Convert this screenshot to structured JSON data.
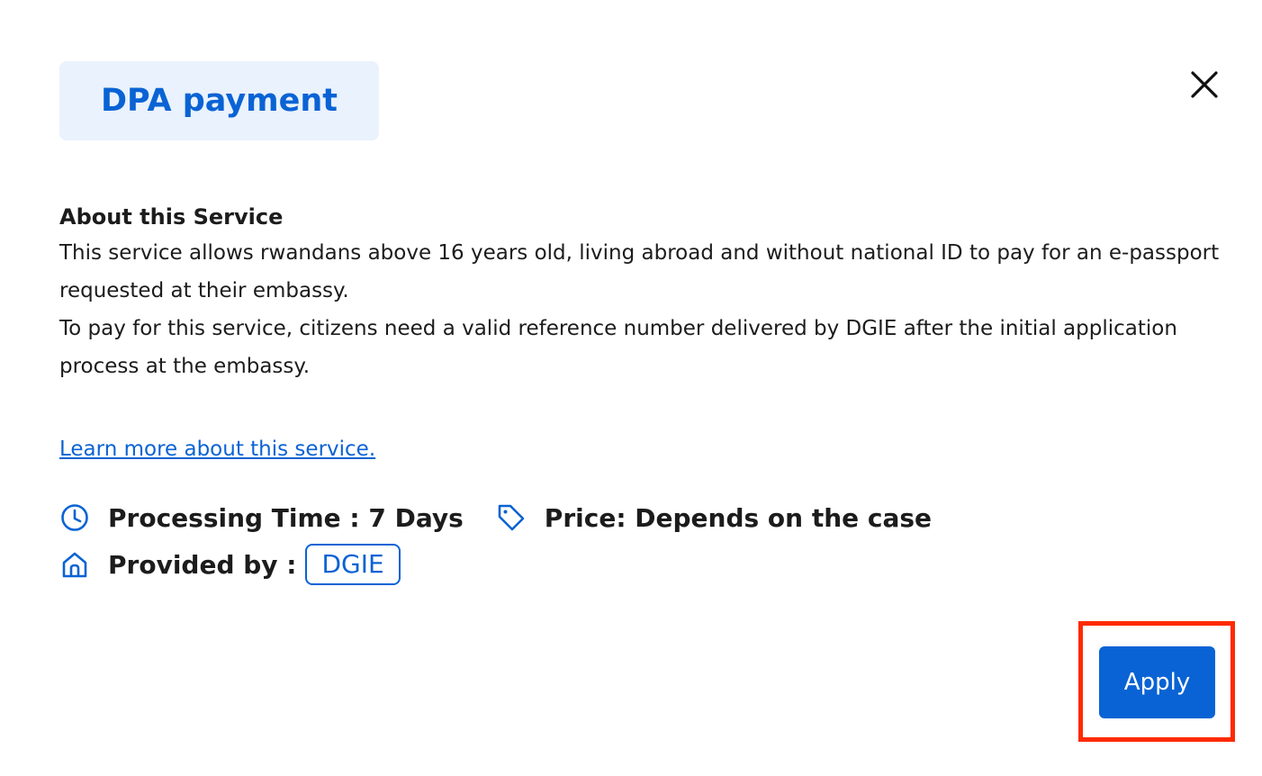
{
  "dialog": {
    "title": "DPA payment",
    "close_icon": "close-icon"
  },
  "about": {
    "heading": "About this Service",
    "line1": "This service allows rwandans above 16 years old, living abroad and without national ID to pay for an e-passport requested at their embassy.",
    "line2": "To pay for this service, citizens need a valid reference number delivered by DGIE after the initial application process at the embassy."
  },
  "learn_more": "Learn more about this service.",
  "meta": {
    "processing_time": "Processing Time : 7 Days",
    "processing_icon": "clock-icon",
    "price": "Price: Depends on the case",
    "price_icon": "tag-icon",
    "provided_by_label": "Provided by :",
    "provided_by_icon": "home-icon",
    "provider": "DGIE"
  },
  "actions": {
    "apply_label": "Apply"
  },
  "colors": {
    "accent": "#0a63d4",
    "title_bg": "#eaf2fd",
    "highlight": "#ff2a00"
  }
}
